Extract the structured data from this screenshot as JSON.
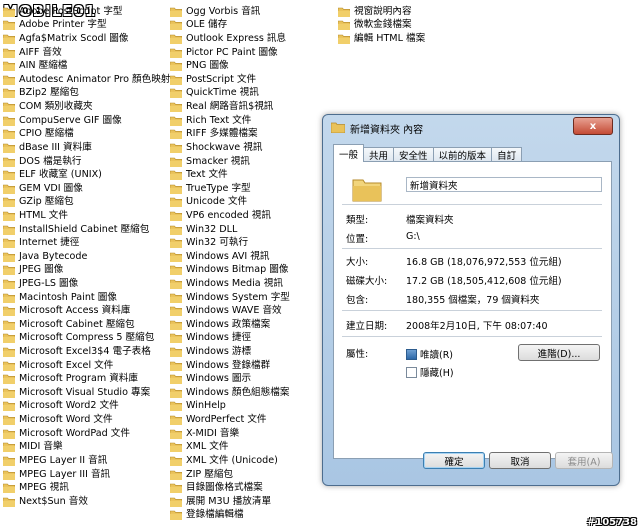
{
  "logo": "MOBILE01",
  "watermark": "#105738",
  "col1": [
    "Adobe PostScript 字型",
    "Adobe Printer 字型",
    "Agfa$Matrix Scodl 圖像",
    "AIFF 音效",
    "AIN 壓縮檔",
    "Autodesc Animator Pro 顏色映射",
    "BZip2 壓縮包",
    "COM 類別收藏夾",
    "CompuServe GIF 圖像",
    "CPIO 壓縮檔",
    "dBase III 資料庫",
    "DOS 檔是執行",
    "ELF 收藏室 (UNIX)",
    "GEM VDI 圖像",
    "GZip 壓縮包",
    "HTML 文件",
    "InstallShield Cabinet 壓縮包",
    "Internet 捷徑",
    "Java Bytecode",
    "JPEG 圖像",
    "JPEG-LS 圖像",
    "Macintosh Paint 圖像",
    "Microsoft Access 資料庫",
    "Microsoft Cabinet 壓縮包",
    "Microsoft Compress 5 壓縮包",
    "Microsoft Excel3$4 電子表格",
    "Microsoft Excel 文件",
    "Microsoft Program 資料庫",
    "Microsoft Visual Studio 專案",
    "Microsoft Word2 文件",
    "Microsoft Word 文件",
    "Microsoft WordPad 文件",
    "MIDI 音樂",
    "MPEG Layer II 音訊",
    "MPEG Layer III 音訊",
    "MPEG 視訊",
    "Next$Sun 音效"
  ],
  "col2": [
    "Ogg Vorbis 音訊",
    "OLE 儲存",
    "Outlook Express 訊息",
    "Pictor PC Paint 圖像",
    "PNG 圖像",
    "PostScript 文件",
    "QuickTime 視訊",
    "Real 網路音訊$視訊",
    "Rich Text 文件",
    "RIFF 多媒體檔案",
    "Shockwave 視訊",
    "Smacker 視訊",
    "Text 文件",
    "TrueType 字型",
    "Unicode 文件",
    "VP6 encoded 視訊",
    "Win32 DLL",
    "Win32 可執行",
    "Windows AVI 視訊",
    "Windows Bitmap 圖像",
    "Windows Media 視訊",
    "Windows System 字型",
    "Windows WAVE 音效",
    "Windows 政策檔案",
    "Windows 捷徑",
    "Windows 游標",
    "Windows 登錄檔群",
    "Windows 圖示",
    "Windows 顏色組態檔案",
    "WinHelp",
    "WordPerfect 文件",
    "X-MIDI 音樂",
    "XML 文件",
    "XML 文件 (Unicode)",
    "ZIP 壓縮包",
    "目錄圖像格式檔案",
    "展開 M3U 播放清單",
    "登錄檔編輯檔"
  ],
  "col3": [
    "視窗說明內容",
    "微軟金錢檔案",
    "編輯 HTML 檔案"
  ],
  "dialog": {
    "title": "新增資料夾 內容",
    "close": "x",
    "tabs": [
      "一般",
      "共用",
      "安全性",
      "以前的版本",
      "自訂"
    ],
    "name_value": "新增資料夾",
    "rows1": [
      {
        "label": "類型:",
        "value": "檔案資料夾"
      },
      {
        "label": "位置:",
        "value": "G:\\"
      }
    ],
    "rows2": [
      {
        "label": "大小:",
        "value": "16.8 GB (18,076,972,553 位元組)"
      },
      {
        "label": "磁碟大小:",
        "value": "17.2 GB (18,505,412,608 位元組)"
      },
      {
        "label": "包含:",
        "value": "180,355 個檔案，79 個資料夾"
      }
    ],
    "rows3": [
      {
        "label": "建立日期:",
        "value": "2008年2月10日, 下午 08:07:40"
      }
    ],
    "attr_label": "屬性:",
    "readonly_label": "唯讀(R)",
    "hidden_label": "隱藏(H)",
    "advanced_button": "進階(D)...",
    "ok_button": "確定",
    "cancel_button": "取消",
    "apply_button": "套用(A)"
  }
}
